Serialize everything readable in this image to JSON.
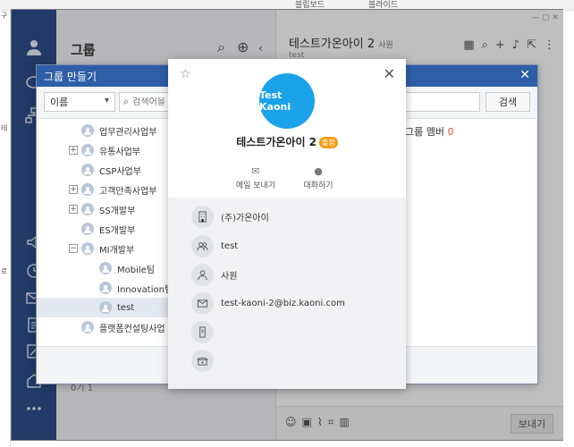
{
  "background": {
    "top_left_text": "구",
    "top_tab_1": "블립보드",
    "top_tab_2": "블라이드",
    "left_edge_1": "테",
    "left_edge_2": "테",
    "left_edge_3": "로"
  },
  "group_panel": {
    "title": "그룹",
    "bottom_text": "0기  1"
  },
  "chat": {
    "title": "테스트가온아이 2",
    "title_tag": "사원",
    "subtitle": "test",
    "send_label": "보내기"
  },
  "create_group": {
    "title": "그룹 만들기",
    "sort_value": "이름",
    "search_placeholder": "검색어을",
    "search_button": "검색",
    "member_label": "그룹 멤버",
    "member_count": "0",
    "tree": [
      {
        "label": "업무관리사업부",
        "toggle": ""
      },
      {
        "label": "유통사업부",
        "toggle": "+"
      },
      {
        "label": "CSP사업부",
        "toggle": ""
      },
      {
        "label": "고객만족사업부",
        "toggle": "+"
      },
      {
        "label": "SS개발부",
        "toggle": "+"
      },
      {
        "label": "ES개발부",
        "toggle": ""
      },
      {
        "label": "MI개발부",
        "toggle": "−"
      },
      {
        "label": "Mobile팀",
        "toggle": ""
      },
      {
        "label": "Innovation팀",
        "toggle": ""
      },
      {
        "label": "test",
        "toggle": ""
      },
      {
        "label": "플랫폼컨설팅사업",
        "toggle": ""
      }
    ]
  },
  "profile": {
    "avatar_text": "Test Kaoni",
    "name": "테스트가온아이 2",
    "status_badge": "출장",
    "actions": {
      "mail": "메일 보내기",
      "chat": "대화하기"
    },
    "company": "(주)가온아이",
    "department": "test",
    "position": "사원",
    "email": "test-kaoni-2@biz.kaoni.com",
    "accent_color": "#1aa3e8"
  }
}
